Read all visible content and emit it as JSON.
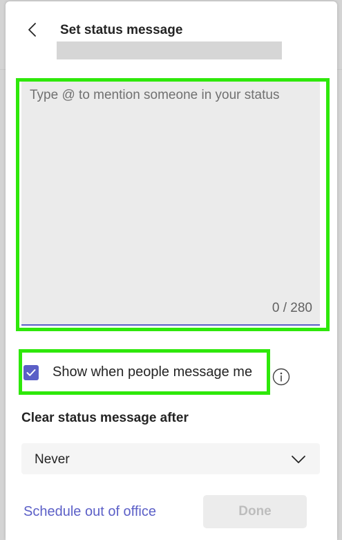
{
  "header": {
    "back_icon": "chevron-left-icon",
    "title": "Set status message"
  },
  "status_input": {
    "value": "",
    "placeholder": "Type @ to mention someone in your status",
    "counter": "0 / 280"
  },
  "show_when_messaged": {
    "checked": true,
    "label": "Show when people message me",
    "info_icon": "info-icon"
  },
  "clear_after": {
    "label": "Clear status message after",
    "selected": "Never",
    "chevron_icon": "chevron-down-icon"
  },
  "footer": {
    "schedule_link": "Schedule out of office",
    "done_label": "Done",
    "done_enabled": false
  },
  "colors": {
    "accent": "#5b5fc7",
    "highlight": "#2ee80a",
    "field_bg": "#ebebeb",
    "disabled_bg": "#ececec",
    "disabled_text": "#bdbdbd"
  }
}
